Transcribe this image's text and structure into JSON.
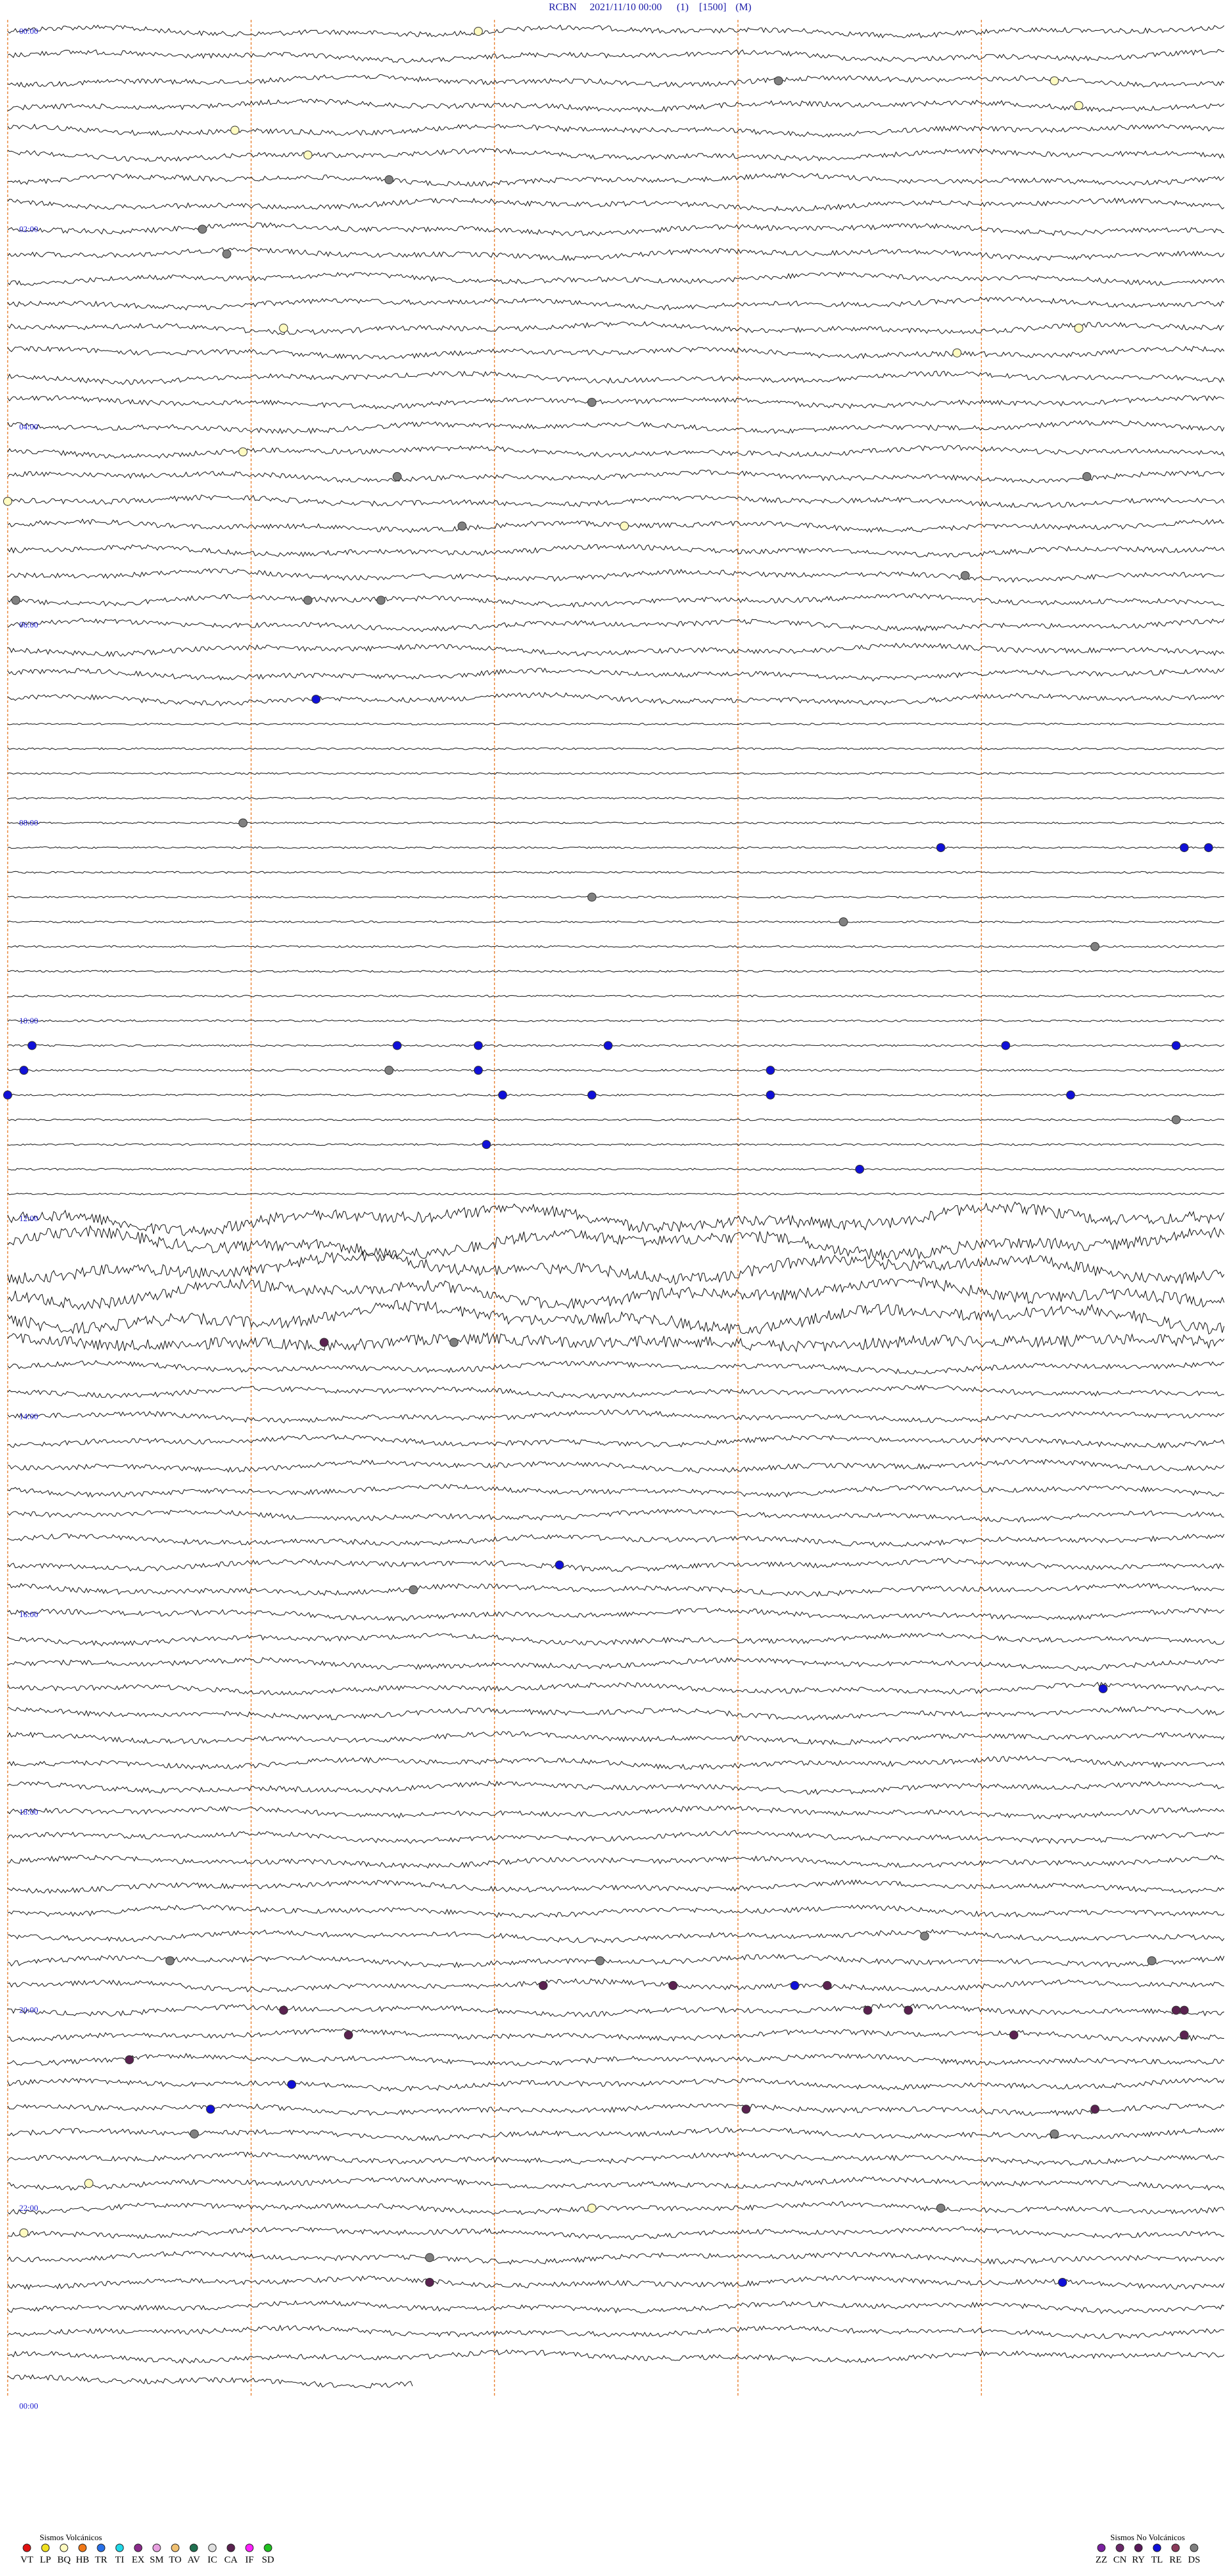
{
  "header": {
    "station": "RCBN",
    "datetime": "2021/11/10 00:00",
    "channel": "(1)",
    "scale": "[1500]",
    "unit": "(M)"
  },
  "chart_data": {
    "type": "helicorder",
    "hour_labels": [
      "00:00",
      "02:00",
      "04:00",
      "06:00",
      "08:00",
      "10:00",
      "12:00",
      "14:00",
      "16:00",
      "18:00",
      "20:00",
      "22:00",
      "00:00"
    ],
    "lines_per_hour": 4,
    "minutes_per_line": 15,
    "event_markers": [
      {
        "line": 0,
        "minute": 5.8,
        "type": "BQ"
      },
      {
        "line": 2,
        "minute": 12.9,
        "type": "BQ"
      },
      {
        "line": 3,
        "minute": 13.2,
        "type": "BQ"
      },
      {
        "line": 2,
        "minute": 9.5,
        "type": "DS"
      },
      {
        "line": 4,
        "minute": 2.8,
        "type": "BQ"
      },
      {
        "line": 5,
        "minute": 3.7,
        "type": "BQ"
      },
      {
        "line": 6,
        "minute": 4.7,
        "type": "DS"
      },
      {
        "line": 8,
        "minute": 2.4,
        "type": "DS"
      },
      {
        "line": 9,
        "minute": 2.7,
        "type": "DS"
      },
      {
        "line": 12,
        "minute": 13.2,
        "type": "BQ"
      },
      {
        "line": 12,
        "minute": 3.4,
        "type": "BQ"
      },
      {
        "line": 13,
        "minute": 11.7,
        "type": "BQ"
      },
      {
        "line": 15,
        "minute": 7.2,
        "type": "DS"
      },
      {
        "line": 17,
        "minute": 2.9,
        "type": "BQ"
      },
      {
        "line": 18,
        "minute": 4.8,
        "type": "DS"
      },
      {
        "line": 18,
        "minute": 13.3,
        "type": "DS"
      },
      {
        "line": 19,
        "minute": 0.0,
        "type": "BQ"
      },
      {
        "line": 20,
        "minute": 5.6,
        "type": "DS"
      },
      {
        "line": 20,
        "minute": 7.6,
        "type": "BQ"
      },
      {
        "line": 22,
        "minute": 11.8,
        "type": "DS"
      },
      {
        "line": 23,
        "minute": 0.1,
        "type": "DS"
      },
      {
        "line": 23,
        "minute": 3.7,
        "type": "DS"
      },
      {
        "line": 23,
        "minute": 4.6,
        "type": "DS"
      },
      {
        "line": 27,
        "minute": 3.8,
        "type": "TL"
      },
      {
        "line": 32,
        "minute": 2.9,
        "type": "DS"
      },
      {
        "line": 33,
        "minute": 11.5,
        "type": "TL"
      },
      {
        "line": 33,
        "minute": 14.5,
        "type": "TL"
      },
      {
        "line": 33,
        "minute": 14.8,
        "type": "TL"
      },
      {
        "line": 35,
        "minute": 7.2,
        "type": "DS"
      },
      {
        "line": 36,
        "minute": 10.3,
        "type": "DS"
      },
      {
        "line": 37,
        "minute": 13.4,
        "type": "DS"
      },
      {
        "line": 41,
        "minute": 0.3,
        "type": "TL"
      },
      {
        "line": 41,
        "minute": 4.8,
        "type": "TL"
      },
      {
        "line": 41,
        "minute": 5.8,
        "type": "TL"
      },
      {
        "line": 41,
        "minute": 7.4,
        "type": "TL"
      },
      {
        "line": 41,
        "minute": 12.3,
        "type": "TL"
      },
      {
        "line": 41,
        "minute": 14.4,
        "type": "TL"
      },
      {
        "line": 42,
        "minute": 0.2,
        "type": "TL"
      },
      {
        "line": 42,
        "minute": 5.8,
        "type": "TL"
      },
      {
        "line": 42,
        "minute": 4.7,
        "type": "DS"
      },
      {
        "line": 42,
        "minute": 9.4,
        "type": "TL"
      },
      {
        "line": 43,
        "minute": 0.0,
        "type": "TL"
      },
      {
        "line": 43,
        "minute": 6.1,
        "type": "TL"
      },
      {
        "line": 43,
        "minute": 7.2,
        "type": "TL"
      },
      {
        "line": 43,
        "minute": 9.4,
        "type": "TL"
      },
      {
        "line": 43,
        "minute": 13.1,
        "type": "TL"
      },
      {
        "line": 44,
        "minute": 14.4,
        "type": "DS"
      },
      {
        "line": 45,
        "minute": 5.9,
        "type": "TL"
      },
      {
        "line": 46,
        "minute": 10.5,
        "type": "TL"
      },
      {
        "line": 53,
        "minute": 5.5,
        "type": "DS"
      },
      {
        "line": 53,
        "minute": 3.9,
        "type": "CA"
      },
      {
        "line": 62,
        "minute": 6.8,
        "type": "TL"
      },
      {
        "line": 63,
        "minute": 5.0,
        "type": "DS"
      },
      {
        "line": 67,
        "minute": 13.5,
        "type": "TL"
      },
      {
        "line": 77,
        "minute": 11.3,
        "type": "DS"
      },
      {
        "line": 78,
        "minute": 2.0,
        "type": "DS"
      },
      {
        "line": 78,
        "minute": 7.3,
        "type": "DS"
      },
      {
        "line": 78,
        "minute": 14.1,
        "type": "DS"
      },
      {
        "line": 79,
        "minute": 8.2,
        "type": "CA"
      },
      {
        "line": 79,
        "minute": 9.7,
        "type": "TL"
      },
      {
        "line": 79,
        "minute": 10.1,
        "type": "CA"
      },
      {
        "line": 79,
        "minute": 6.6,
        "type": "CA"
      },
      {
        "line": 80,
        "minute": 3.4,
        "type": "CA"
      },
      {
        "line": 80,
        "minute": 10.6,
        "type": "CA"
      },
      {
        "line": 80,
        "minute": 11.1,
        "type": "CA"
      },
      {
        "line": 80,
        "minute": 14.4,
        "type": "CA"
      },
      {
        "line": 80,
        "minute": 14.5,
        "type": "CA"
      },
      {
        "line": 81,
        "minute": 4.2,
        "type": "CA"
      },
      {
        "line": 81,
        "minute": 14.5,
        "type": "CA"
      },
      {
        "line": 81,
        "minute": 12.4,
        "type": "CA"
      },
      {
        "line": 82,
        "minute": 1.5,
        "type": "CA"
      },
      {
        "line": 83,
        "minute": 3.5,
        "type": "TL"
      },
      {
        "line": 84,
        "minute": 2.5,
        "type": "TL"
      },
      {
        "line": 84,
        "minute": 9.1,
        "type": "CA"
      },
      {
        "line": 84,
        "minute": 13.4,
        "type": "CA"
      },
      {
        "line": 85,
        "minute": 12.9,
        "type": "DS"
      },
      {
        "line": 85,
        "minute": 2.3,
        "type": "DS"
      },
      {
        "line": 87,
        "minute": 1.0,
        "type": "BQ"
      },
      {
        "line": 88,
        "minute": 7.2,
        "type": "BQ"
      },
      {
        "line": 88,
        "minute": 11.5,
        "type": "DS"
      },
      {
        "line": 89,
        "minute": 0.2,
        "type": "BQ"
      },
      {
        "line": 90,
        "minute": 5.2,
        "type": "DS"
      },
      {
        "line": 91,
        "minute": 5.2,
        "type": "CA"
      },
      {
        "line": 91,
        "minute": 13.0,
        "type": "TL"
      }
    ],
    "grid_minutes": [
      0,
      3,
      6,
      9,
      12
    ],
    "flat_lines": [
      28,
      29,
      30,
      31,
      32,
      33,
      34,
      35,
      36,
      37,
      38,
      39,
      40,
      41,
      42,
      43,
      44,
      45,
      46,
      47
    ]
  },
  "legend": {
    "volcanic_title": "Sismos Volcánicos",
    "volcanic": [
      {
        "code": "VT",
        "color": "#e01010"
      },
      {
        "code": "LP",
        "color": "#f0e020"
      },
      {
        "code": "BQ",
        "color": "#fffbc0"
      },
      {
        "code": "HB",
        "color": "#f07818"
      },
      {
        "code": "TR",
        "color": "#2870e8"
      },
      {
        "code": "TI",
        "color": "#20d8e8"
      },
      {
        "code": "EX",
        "color": "#8a2a8a"
      },
      {
        "code": "SM",
        "color": "#e8a0e0"
      },
      {
        "code": "TO",
        "color": "#f0c070"
      },
      {
        "code": "AV",
        "color": "#207050"
      },
      {
        "code": "IC",
        "color": "#e0e0e0"
      },
      {
        "code": "CA",
        "color": "#5a2250"
      },
      {
        "code": "IF",
        "color": "#ff20ff"
      },
      {
        "code": "SD",
        "color": "#20c020"
      }
    ],
    "nonvolcanic_title": "Sismos No Volcánicos",
    "nonvolcanic": [
      {
        "code": "ZZ",
        "color": "#7a20a0"
      },
      {
        "code": "CN",
        "color": "#6a2868"
      },
      {
        "code": "RY",
        "color": "#5a1a5a"
      },
      {
        "code": "TL",
        "color": "#1010d8"
      },
      {
        "code": "RE",
        "color": "#8a3a5a"
      },
      {
        "code": "DS",
        "color": "#808080"
      }
    ]
  }
}
